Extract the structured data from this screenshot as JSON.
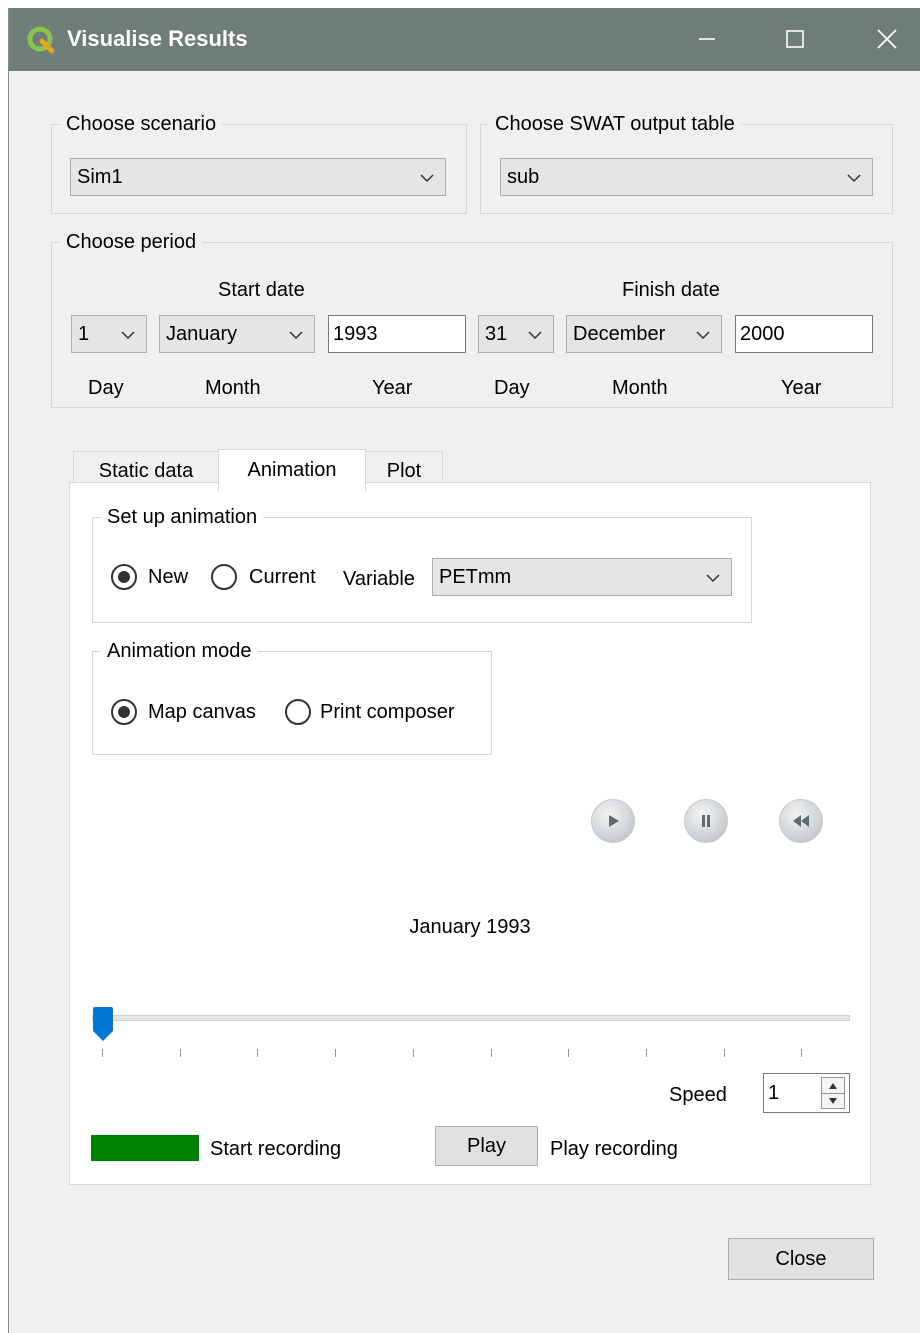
{
  "window": {
    "title": "Visualise Results"
  },
  "scenario": {
    "group_label": "Choose scenario",
    "value": "Sim1"
  },
  "output_table": {
    "group_label": "Choose SWAT output table",
    "value": "sub"
  },
  "period": {
    "group_label": "Choose period",
    "start_label": "Start date",
    "finish_label": "Finish date",
    "start": {
      "day": "1",
      "month": "January",
      "year": "1993"
    },
    "finish": {
      "day": "31",
      "month": "December",
      "year": "2000"
    },
    "day_label": "Day",
    "month_label": "Month",
    "year_label": "Year"
  },
  "tabs": [
    {
      "label": "Static data",
      "active": false
    },
    {
      "label": "Animation",
      "active": true
    },
    {
      "label": "Plot",
      "active": false
    }
  ],
  "setup": {
    "group_label": "Set up animation",
    "new_label": "New",
    "new_checked": true,
    "current_label": "Current",
    "current_checked": false,
    "variable_label": "Variable",
    "variable_value": "PETmm"
  },
  "mode": {
    "group_label": "Animation mode",
    "map_canvas_label": "Map canvas",
    "map_canvas_checked": true,
    "print_composer_label": "Print composer",
    "print_composer_checked": false
  },
  "media_icons": [
    "play-icon",
    "pause-icon",
    "rewind-icon"
  ],
  "animation": {
    "date_label": "January 1993",
    "slider_fraction": 0.0,
    "speed_label": "Speed",
    "speed_value": "1",
    "start_recording_label": "Start recording",
    "recording_color": "#008000",
    "play_button_label": "Play",
    "play_recording_label": "Play recording"
  },
  "close_button_label": "Close",
  "colors": {
    "titlebar": "#6e7d78",
    "slider_handle": "#0078d7",
    "recording": "#008000"
  }
}
